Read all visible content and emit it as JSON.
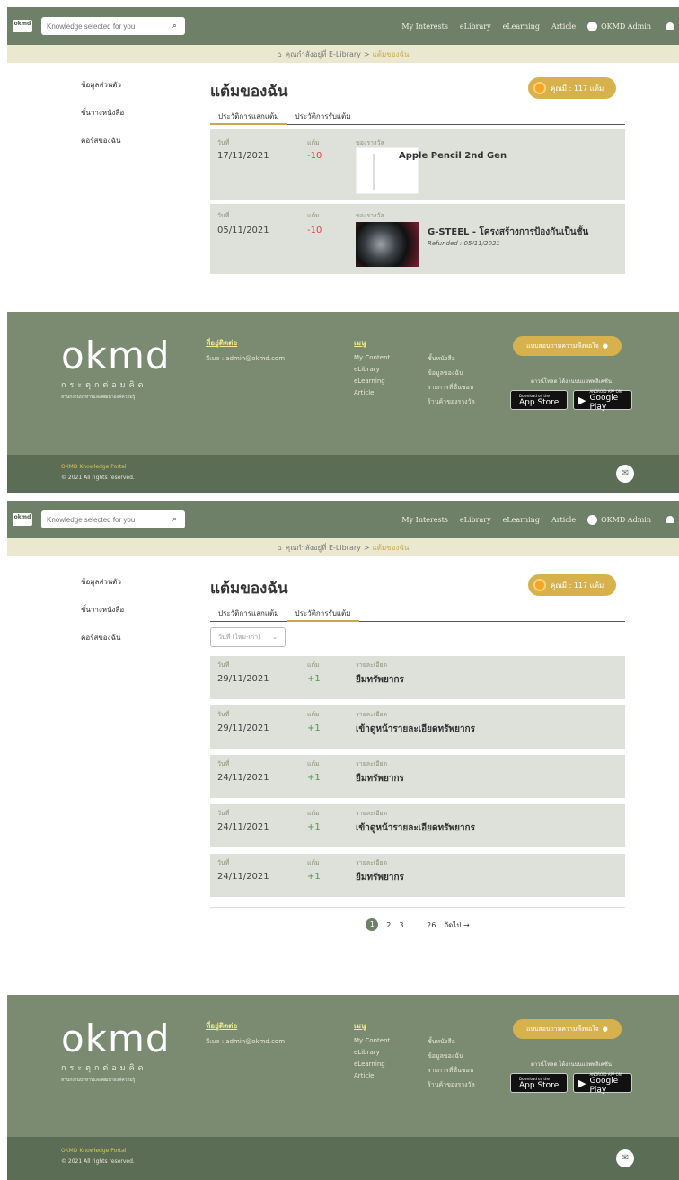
{
  "nav": {
    "logo": "okmd",
    "search_placeholder": "Knowledge selected for you",
    "links": [
      "My Interests",
      "eLibrary",
      "eLearning",
      "Article"
    ],
    "user": "OKMD Admin",
    "links2": [
      "My Interests",
      "eLibrary",
      "eLearning",
      "Article"
    ]
  },
  "breadcrumb": {
    "prefix": "คุณกำลังอยู่ที่ E-Library",
    "sep": ">",
    "current": "แต้มของฉัน"
  },
  "sidebar": [
    "ข้อมูลส่วนตัว",
    "ชั้นวางหนังสือ",
    "คอร์สของฉัน"
  ],
  "page": {
    "title": "แต้มของฉัน",
    "points": "คุณมี : 117 แต้ม"
  },
  "tabs": [
    "ประวัติการแลกแต้ม",
    "ประวัติการรับแต้ม"
  ],
  "labels": {
    "date": "วันที่",
    "points": "แต้ม",
    "reward": "ของรางวัล",
    "detail": "รายละเอียด"
  },
  "redeem": [
    {
      "date": "17/11/2021",
      "points": "-10",
      "item": "Apple Pencil 2nd Gen",
      "refund": ""
    },
    {
      "date": "05/11/2021",
      "points": "-10",
      "item": "G-STEEL - โครงสร้างการป้องกันเป็นชั้น",
      "refund": "Refunded : 05/11/2021"
    }
  ],
  "sort_select": "วันที่ (ใหม่-เก่า)",
  "earn": [
    {
      "date": "29/11/2021",
      "points": "+1",
      "detail": "ยืมทรัพยากร"
    },
    {
      "date": "29/11/2021",
      "points": "+1",
      "detail": "เข้าดูหน้ารายละเอียดทรัพยากร"
    },
    {
      "date": "24/11/2021",
      "points": "+1",
      "detail": "ยืมทรัพยากร"
    },
    {
      "date": "24/11/2021",
      "points": "+1",
      "detail": "เข้าดูหน้ารายละเอียดทรัพยากร"
    },
    {
      "date": "24/11/2021",
      "points": "+1",
      "detail": "ยืมทรัพยากร"
    }
  ],
  "pagination": {
    "pages": [
      "1",
      "2",
      "3",
      "...",
      "26"
    ],
    "next": "ถัดไป →"
  },
  "footer": {
    "brand": "okmd",
    "brand_thai": "กระตุกต่อมคิด",
    "brand_sub": "สำนักงานบริหารและพัฒนาองค์ความรู้",
    "contact_head": "ที่อยู่ติดต่อ",
    "contact_email": "อีเมล : admin@okmd.com",
    "menu_head": "เมนู",
    "menu_col1": [
      "My Content",
      "eLibrary",
      "eLearning",
      "Article"
    ],
    "menu_col2": [
      "ชั้นหนังสือ",
      "ข้อมูลของฉัน",
      "รายการที่ชื่นชอบ",
      "ร้านค้าของรางวัล"
    ],
    "survey": "แบบสอบถามความพึงพอใจ",
    "download": "ดาวน์โหลด ได้งานบนแอพพลิเคชัน",
    "appstore_small": "Download on the",
    "appstore_big": "App Store",
    "gplay_small": "ANDROID APP ON",
    "gplay_big": "Google Play",
    "portal": "OKMD Knowledge Portal",
    "copyright": "© 2021 All rights reserved."
  },
  "colors": {
    "navbar": "#6f8068",
    "accent": "#c8a94d",
    "negative": "#e04444",
    "positive": "#4b9b50"
  }
}
